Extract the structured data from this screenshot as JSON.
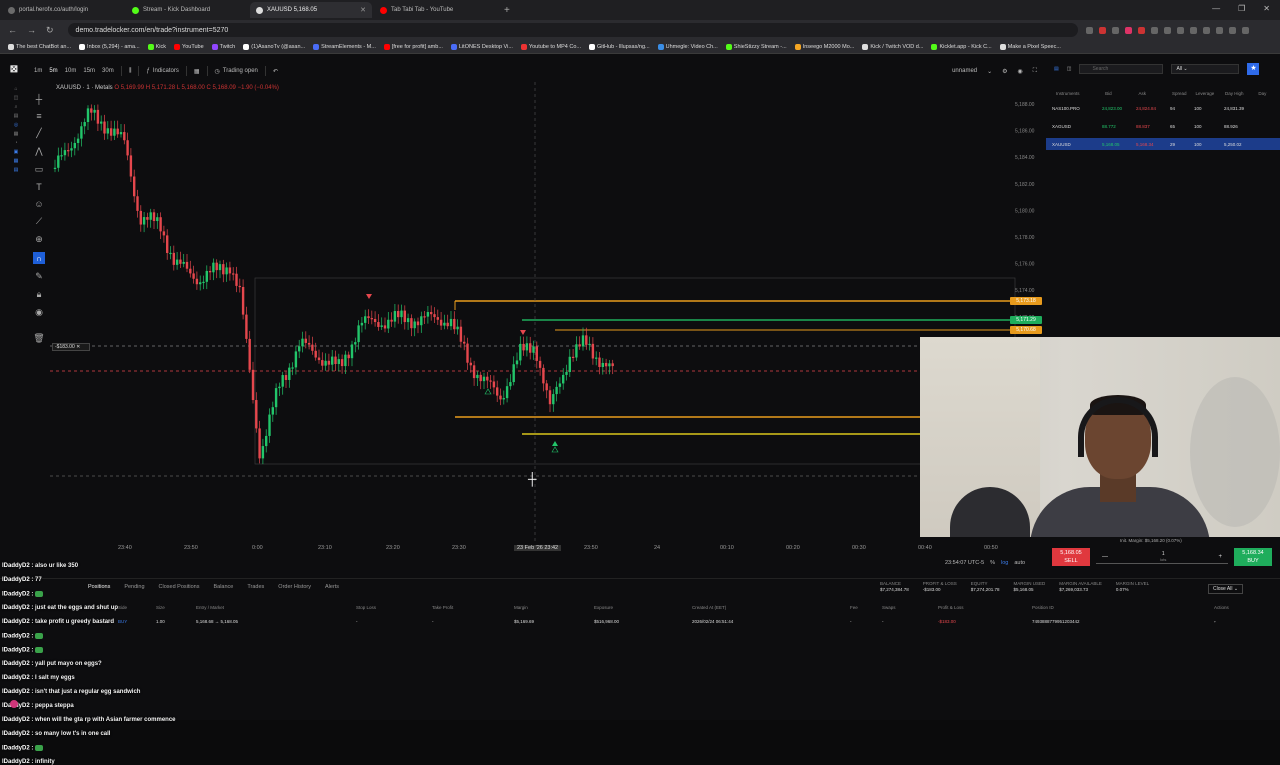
{
  "browser": {
    "tabs": [
      {
        "title": "portal.herofx.co/auth/login",
        "color": "#6b6b6b"
      },
      {
        "title": "Stream - Kick Dashboard",
        "color": "#53fc18"
      },
      {
        "title": "XAUUSD 5,168.05",
        "color": "#dddddd"
      },
      {
        "title": "Tab Tabi Tab - YouTube",
        "color": "#ff0000"
      }
    ],
    "url": "demo.tradelocker.com/en/trade?instrument=5270",
    "bookmarks": [
      {
        "label": "The best ChatBot an...",
        "color": "#ddd"
      },
      {
        "label": "Inbox (5,294) - ama...",
        "color": "#fff"
      },
      {
        "label": "Kick",
        "color": "#53fc18"
      },
      {
        "label": "YouTube",
        "color": "#ff0000"
      },
      {
        "label": "Twitch",
        "color": "#9146ff"
      },
      {
        "label": "(1)AsanoTv (@asan...",
        "color": "#fff"
      },
      {
        "label": "StreamElements - M...",
        "color": "#4a6cf7"
      },
      {
        "label": "[free for profit] amb...",
        "color": "#ff0000"
      },
      {
        "label": "LitONES Desktop Vi...",
        "color": "#4a6cf7"
      },
      {
        "label": "Youtube to MP4 Co...",
        "color": "#e33"
      },
      {
        "label": "GitHub - lllupsas/ng...",
        "color": "#fff"
      },
      {
        "label": "Uhmegle: Video Ch...",
        "color": "#3a8ee6"
      },
      {
        "label": "ShieStizzy Stream -...",
        "color": "#53fc18"
      },
      {
        "label": "Inseego M2000 Mo...",
        "color": "#f5a623"
      },
      {
        "label": "Kick / Twitch VOD d...",
        "color": "#ddd"
      },
      {
        "label": "Kicklet.app - Kick C...",
        "color": "#53fc18"
      },
      {
        "label": "Make a Pixel Speec...",
        "color": "#ddd"
      }
    ]
  },
  "toolbar": {
    "timeframes": [
      "1m",
      "5m",
      "10m",
      "15m",
      "30m"
    ],
    "indicators": "Indicators",
    "trading": "Trading open",
    "layout": "unnamed"
  },
  "symbol_line": {
    "name": "XAUUSD · 1 · Metals",
    "ohlc": "O 5,169.99 H 5,171.28 L 5,168.00 C 5,168.09 −1.90 (−0.04%)"
  },
  "chart": {
    "yaxis_ticks": [
      "5,188.00",
      "5,186.00",
      "5,184.00",
      "5,182.00",
      "5,180.00",
      "5,178.00",
      "5,176.00",
      "5,174.00",
      "5,172.00"
    ],
    "price_tags": [
      {
        "label": "5,173.18",
        "color": "#e89b1d"
      },
      {
        "label": "5,171.29",
        "color": "#1fad5c"
      },
      {
        "label": "5,170.68",
        "color": "#e89b1d"
      }
    ],
    "position_tag": "-$183.00",
    "time_labels": [
      "23:40",
      "23:50",
      "0:00",
      "23:10",
      "23:20",
      "23:30",
      "23 Feb '26 23:42",
      "23:50",
      "24",
      "00:10",
      "00:20",
      "00:30",
      "00:40",
      "00:50"
    ],
    "timezone": "23:54:07 UTC-5",
    "scale_pct": "%",
    "scale_log": "log",
    "scale_auto": "auto"
  },
  "order_panel": {
    "sell_price": "5,168.05",
    "sell_label": "SELL",
    "buy_price": "5,168.34",
    "buy_label": "BUY",
    "lots": "1",
    "lots_unit": "lots",
    "margin_info": "Init. Margin: $5,168.20 (0.07%)"
  },
  "watchlist": {
    "filter": "All",
    "search_placeholder": "Search",
    "columns": [
      "Instruments",
      "Bid",
      "Ask",
      "Spread",
      "Leverage",
      "Day High",
      "Day"
    ],
    "rows": [
      {
        "symbol": "NAS100.PRO",
        "bid": "24,823.00",
        "ask": "24,824.84",
        "spread": "94",
        "lev": "100",
        "high": "24,831.39"
      },
      {
        "symbol": "XAGUSD",
        "bid": "88.772",
        "ask": "88.837",
        "spread": "65",
        "lev": "100",
        "high": "88.926"
      },
      {
        "symbol": "XAUUSD",
        "bid": "5,168.05",
        "ask": "5,168.34",
        "spread": "29",
        "lev": "100",
        "high": "5,250.02"
      }
    ]
  },
  "bottom": {
    "tabs": [
      "Positions",
      "Pending",
      "Closed Positions",
      "Balance",
      "Trades",
      "Order History",
      "Alerts"
    ],
    "account": [
      {
        "label": "BALANCE",
        "value": "$7,274,384.78"
      },
      {
        "label": "PROFIT & LOSS",
        "value": "-$183.00"
      },
      {
        "label": "EQUITY",
        "value": "$7,274,201.78"
      },
      {
        "label": "MARGIN USED",
        "value": "$5,168.05"
      },
      {
        "label": "MARGIN AVAILABLE",
        "value": "$7,269,033.73"
      },
      {
        "label": "MARGIN LEVEL",
        "value": "0.07%"
      }
    ],
    "close_all": "Close All",
    "columns": [
      "Side",
      "Size",
      "Entry / Market",
      "Stop Loss",
      "Take Profit",
      "Margin",
      "Exposure",
      "Created At (EET)",
      "Fee",
      "Swaps",
      "Profit & Loss",
      "Position ID",
      "Actions"
    ],
    "position": {
      "side": "BUY",
      "size": "1.00",
      "entry": "5,168.68 → 5,168.05",
      "sl": "-",
      "tp": "-",
      "margin": "$5,169.69",
      "exposure": "$516,968.00",
      "created": "2026/02/24 06:51:44",
      "fee": "-",
      "swaps": "-",
      "pnl": "-$183.00",
      "id": "7493888779951203442"
    }
  },
  "chat": [
    {
      "user": "lDaddyD2 :",
      "msg": "also ur like 350"
    },
    {
      "user": "lDaddyD2 :",
      "msg": "77"
    },
    {
      "user": "lDaddyD2 :",
      "msg": ""
    },
    {
      "user": "lDaddyD2 :",
      "msg": "just eat the eggs and shut up"
    },
    {
      "user": "lDaddyD2 :",
      "msg": "take profit u greedy bastard"
    },
    {
      "user": "lDaddyD2 :",
      "msg": ""
    },
    {
      "user": "lDaddyD2 :",
      "msg": ""
    },
    {
      "user": "lDaddyD2 :",
      "msg": "yall put mayo on eggs?"
    },
    {
      "user": "lDaddyD2 :",
      "msg": "I salt my eggs"
    },
    {
      "user": "lDaddyD2 :",
      "msg": "isn't that just a regular egg sandwich"
    },
    {
      "user": "lDaddyD2 :",
      "msg": "peppa steppa"
    },
    {
      "user": "lDaddyD2 :",
      "msg": "when will the gta rp with Asian farmer commence"
    },
    {
      "user": "lDaddyD2 :",
      "msg": "so many low t's in one call"
    },
    {
      "user": "lDaddyD2 :",
      "msg": ""
    },
    {
      "user": "lDaddyD2 :",
      "msg": "infinity"
    }
  ],
  "colors": {
    "up": "#22c56a",
    "down": "#e5474d",
    "orange": "#e89b1d",
    "yellow": "#d9c51c",
    "green_line": "#1fad5c",
    "accent": "#2f6bea"
  }
}
